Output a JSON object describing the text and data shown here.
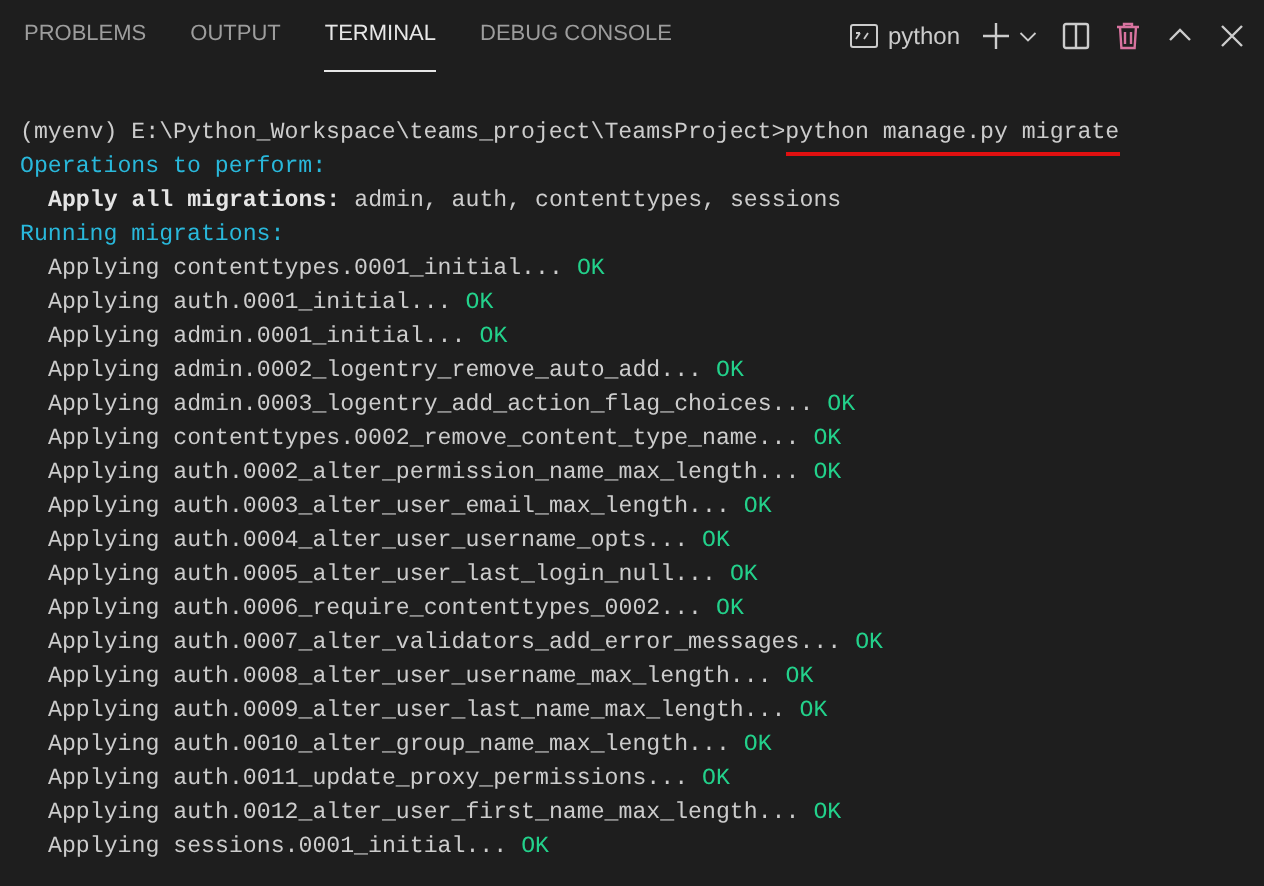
{
  "tabs": [
    {
      "label": "PROBLEMS",
      "selected": false
    },
    {
      "label": "OUTPUT",
      "selected": false
    },
    {
      "label": "TERMINAL",
      "selected": true
    },
    {
      "label": "DEBUG CONSOLE",
      "selected": false
    }
  ],
  "terminal_name": "python",
  "lines": [
    {
      "kind": "prompt",
      "prompt": "(myenv) E:\\Python_Workspace\\teams_project\\TeamsProject>",
      "command": "python manage.py migrate"
    },
    {
      "kind": "heading",
      "text": "Operations to perform:"
    },
    {
      "kind": "plan",
      "label": "Apply all migrations:",
      "text": "admin, auth, contenttypes, sessions"
    },
    {
      "kind": "heading",
      "text": "Running migrations:"
    },
    {
      "kind": "step",
      "text": "Applying contenttypes.0001_initial...",
      "status": "OK"
    },
    {
      "kind": "step",
      "text": "Applying auth.0001_initial...",
      "status": "OK"
    },
    {
      "kind": "step",
      "text": "Applying admin.0001_initial...",
      "status": "OK"
    },
    {
      "kind": "step",
      "text": "Applying admin.0002_logentry_remove_auto_add...",
      "status": "OK"
    },
    {
      "kind": "step",
      "text": "Applying admin.0003_logentry_add_action_flag_choices...",
      "status": "OK"
    },
    {
      "kind": "step",
      "text": "Applying contenttypes.0002_remove_content_type_name...",
      "status": "OK"
    },
    {
      "kind": "step",
      "text": "Applying auth.0002_alter_permission_name_max_length...",
      "status": "OK"
    },
    {
      "kind": "step",
      "text": "Applying auth.0003_alter_user_email_max_length...",
      "status": "OK"
    },
    {
      "kind": "step",
      "text": "Applying auth.0004_alter_user_username_opts...",
      "status": "OK"
    },
    {
      "kind": "step",
      "text": "Applying auth.0005_alter_user_last_login_null...",
      "status": "OK"
    },
    {
      "kind": "step",
      "text": "Applying auth.0006_require_contenttypes_0002...",
      "status": "OK"
    },
    {
      "kind": "step",
      "text": "Applying auth.0007_alter_validators_add_error_messages...",
      "status": "OK"
    },
    {
      "kind": "step",
      "text": "Applying auth.0008_alter_user_username_max_length...",
      "status": "OK"
    },
    {
      "kind": "step",
      "text": "Applying auth.0009_alter_user_last_name_max_length...",
      "status": "OK"
    },
    {
      "kind": "step",
      "text": "Applying auth.0010_alter_group_name_max_length...",
      "status": "OK"
    },
    {
      "kind": "step",
      "text": "Applying auth.0011_update_proxy_permissions...",
      "status": "OK"
    },
    {
      "kind": "step",
      "text": "Applying auth.0012_alter_user_first_name_max_length...",
      "status": "OK"
    },
    {
      "kind": "step",
      "text": "Applying sessions.0001_initial...",
      "status": "OK"
    }
  ]
}
